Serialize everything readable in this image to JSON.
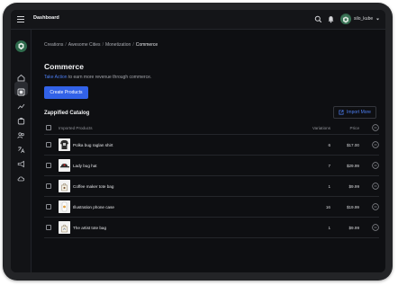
{
  "topbar": {
    "title": "Dashboard",
    "username": "silo_kube"
  },
  "breadcrumb": [
    "Creations",
    "Awesome Cities",
    "Monetization",
    "Commerce"
  ],
  "page": {
    "title": "Commerce",
    "subtitle_link": "Take Action",
    "subtitle_rest": " to earn more revenue through commerce.",
    "create_button": "Create Products",
    "section_title": "Zappified Catalog",
    "import_button": "Import More"
  },
  "table": {
    "headers": {
      "product": "Imported Products",
      "variations": "Variations",
      "price": "Price"
    },
    "rows": [
      {
        "name": "Polka bug raglan shirt",
        "variations": "6",
        "price": "$17.00",
        "thumb": "shirt"
      },
      {
        "name": "Lady bug hat",
        "variations": "7",
        "price": "$29.99",
        "thumb": "hat"
      },
      {
        "name": "Coffee maker tote bag",
        "variations": "1",
        "price": "$9.99",
        "thumb": "bag"
      },
      {
        "name": "Illustration phone case",
        "variations": "16",
        "price": "$19.99",
        "thumb": "phone"
      },
      {
        "name": "The artist tote bag",
        "variations": "1",
        "price": "$9.99",
        "thumb": "bag2"
      }
    ]
  },
  "sidebar": {
    "icons": [
      "home-icon",
      "gallery-icon",
      "analytics-icon",
      "shop-icon",
      "users-icon",
      "translate-icon",
      "megaphone-icon",
      "cloud-icon"
    ],
    "active": "gallery-icon"
  },
  "colors": {
    "accent": "#3262e8",
    "link": "#4c7df0",
    "background": "#0e0f12"
  }
}
